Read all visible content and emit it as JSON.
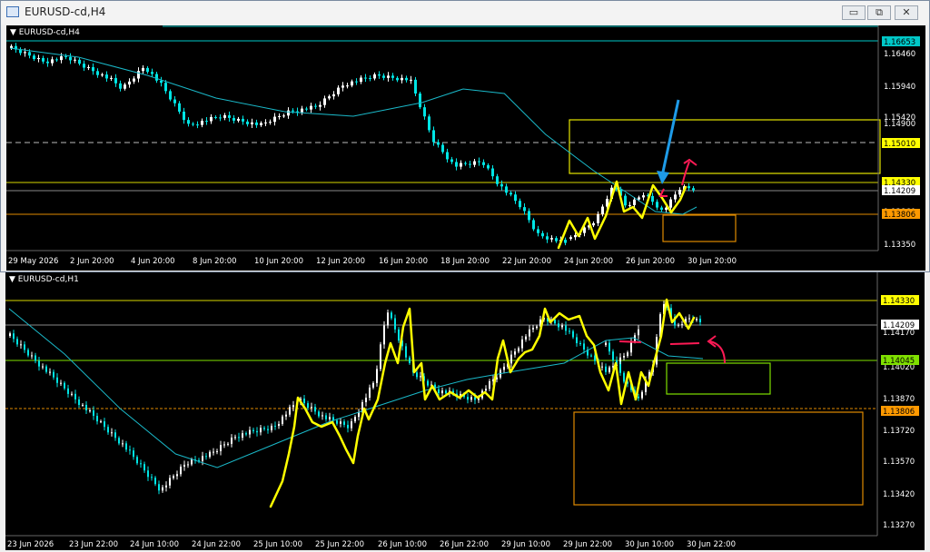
{
  "window": {
    "title": "EURUSD-cd,H4",
    "minimize_glyph": "▭",
    "restore_glyph": "⧉",
    "close_glyph": "✕"
  },
  "top_chart": {
    "label": "EURUSD-cd,H4",
    "price_ticks": [
      "1.16460",
      "1.15940",
      "1.15420",
      "1.14900",
      "1.13860",
      "1.13350"
    ],
    "price_tags": [
      {
        "text": "1.16653",
        "bg": "#00c8c8",
        "fg": "#000000"
      },
      {
        "text": "1.15010",
        "bg": "#ffff00",
        "fg": "#000000"
      },
      {
        "text": "1.14330",
        "bg": "#ffff00",
        "fg": "#000000"
      },
      {
        "text": "1.14209",
        "bg": "#ffffff",
        "fg": "#000000"
      },
      {
        "text": "1.13806",
        "bg": "#ff9900",
        "fg": "#000000"
      }
    ],
    "time_ticks": [
      "29 May 2026",
      "2 Jun 20:00",
      "4 Jun 20:00",
      "8 Jun 20:00",
      "10 Jun 20:00",
      "12 Jun 20:00",
      "16 Jun 20:00",
      "18 Jun 20:00",
      "22 Jun 20:00",
      "24 Jun 20:00",
      "26 Jun 20:00",
      "30 Jun 20:00"
    ]
  },
  "bottom_chart": {
    "label": "EURUSD-cd,H1",
    "price_ticks": [
      "1.14170",
      "1.14020",
      "1.13870",
      "1.13720",
      "1.13570",
      "1.13420",
      "1.13270"
    ],
    "price_tags": [
      {
        "text": "1.14330",
        "bg": "#ffff00",
        "fg": "#000000"
      },
      {
        "text": "1.14209",
        "bg": "#ffffff",
        "fg": "#000000"
      },
      {
        "text": "1.14045",
        "bg": "#7fdf00",
        "fg": "#000000"
      },
      {
        "text": "1.13806",
        "bg": "#ff9900",
        "fg": "#000000"
      }
    ],
    "time_ticks": [
      "23 Jun 2026",
      "23 Jun 22:00",
      "24 Jun 10:00",
      "24 Jun 22:00",
      "25 Jun 10:00",
      "25 Jun 22:00",
      "26 Jun 10:00",
      "26 Jun 22:00",
      "29 Jun 10:00",
      "29 Jun 22:00",
      "30 Jun 10:00",
      "30 Jun 22:00"
    ]
  },
  "colors": {
    "candle_up": "#ffffff",
    "candle_down": "#00e5e5",
    "ma": "#1ab8c8",
    "drawing": "#ffff00",
    "arrow_blue": "#1e9be8",
    "arrow_red": "#ff1a55"
  }
}
